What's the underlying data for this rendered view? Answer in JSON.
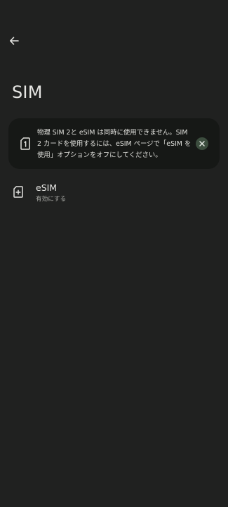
{
  "header": {
    "back_icon": "arrow-left-icon",
    "title": "SIM"
  },
  "notice": {
    "icon": "sim-card-1-icon",
    "text": "物理 SIM 2と eSIM は同時に使用できません。SIM 2 カードを使用するには、eSIM ページで「eSIM を使用」オプションをオフにしてください。",
    "dismiss_icon": "close-icon",
    "accent_color": "#3c4d3e"
  },
  "esim_item": {
    "icon": "esim-add-icon",
    "title": "eSIM",
    "subtitle": "有効にする"
  },
  "colors": {
    "background": "#202120",
    "card": "#161816"
  }
}
